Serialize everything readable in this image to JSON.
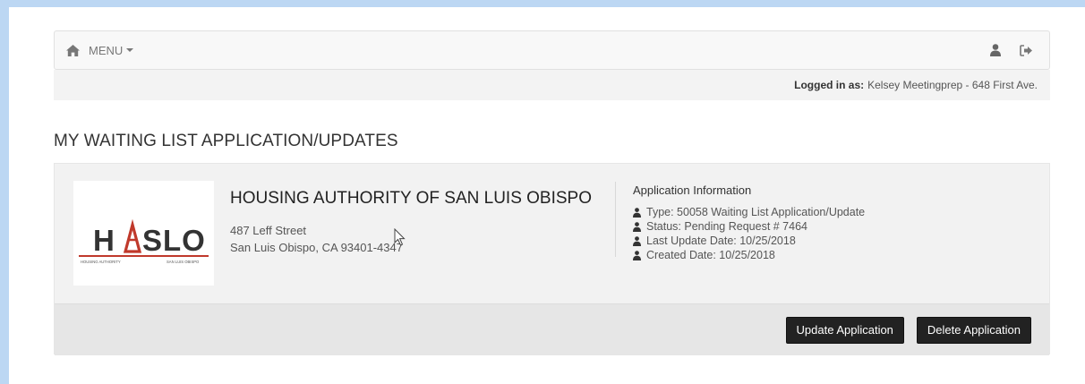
{
  "nav": {
    "menu_label": "MENU",
    "icons": [
      "home-icon",
      "user-icon",
      "sign-out-icon"
    ]
  },
  "login": {
    "prefix": "Logged in as:",
    "user": "Kelsey Meetingprep - 648 First Ave."
  },
  "page_title": "MY WAITING LIST APPLICATION/UPDATES",
  "application": {
    "logo": {
      "wordmark": "HASLO",
      "left_caption": "HOUSING AUTHORITY",
      "right_caption": "SAN LUIS OBISPO",
      "accent_color": "#c0392b",
      "dark_color": "#333333"
    },
    "org_name": "HOUSING AUTHORITY OF SAN LUIS OBISPO",
    "address_line1": "487 Leff Street",
    "address_line2": "San Luis Obispo, CA 93401-4347",
    "info_title": "Application Information",
    "info_rows": [
      "Type: 50058 Waiting List Application/Update",
      "Status: Pending Request # 7464",
      "Last Update Date: 10/25/2018",
      "Created Date: 10/25/2018"
    ]
  },
  "actions": {
    "update_label": "Update Application",
    "delete_label": "Delete Application"
  }
}
